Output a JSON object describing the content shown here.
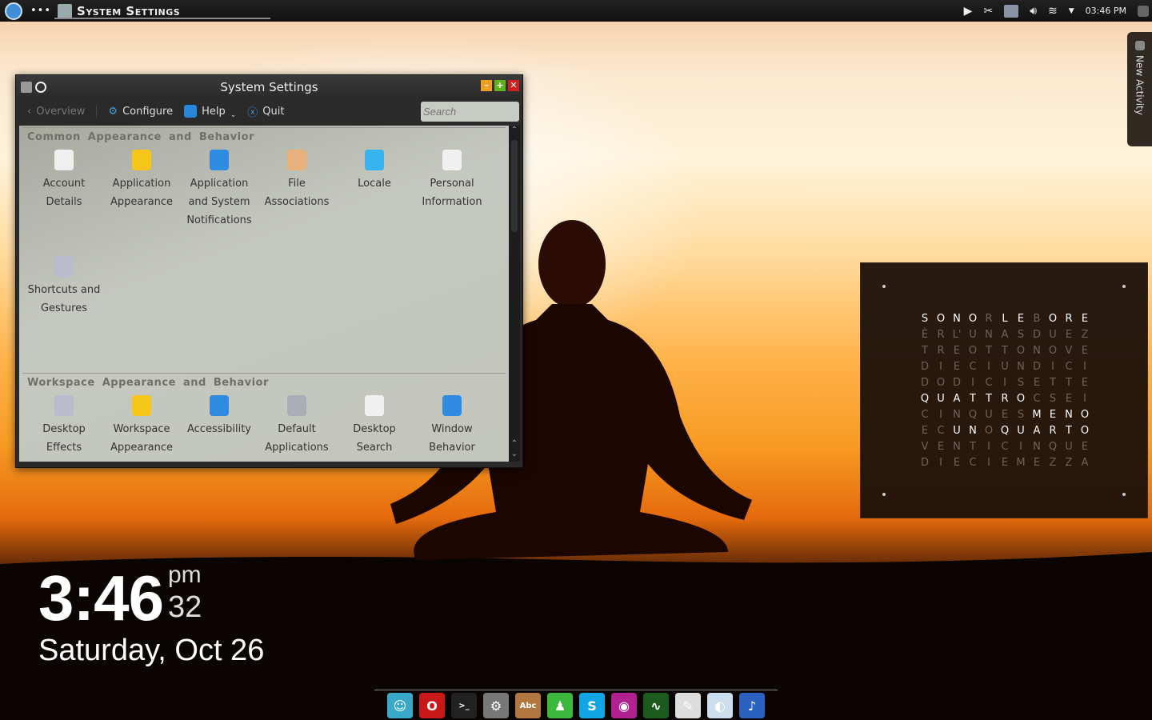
{
  "topbar": {
    "app_title": "System Settings",
    "menu_dots": "•••",
    "clock": "03:46 PM",
    "icons": [
      "kde-launcher-icon",
      "play-icon",
      "scissors-icon",
      "keyboard-icon",
      "volume-icon",
      "wifi-icon",
      "tray-expand-icon",
      "activity-icon"
    ]
  },
  "new_activity": {
    "label": "New Activity"
  },
  "window": {
    "title": "System Settings",
    "toolbar": {
      "overview": "Overview",
      "configure": "Configure",
      "help": "Help",
      "quit": "Quit",
      "search_placeholder": "Search"
    },
    "sections": [
      {
        "title": "Common Appearance and Behavior",
        "items": [
          {
            "label": "Account Details",
            "icon": "account-icon",
            "color": "#f0f0f0"
          },
          {
            "label": "Application Appearance",
            "icon": "shirt-icon",
            "color": "#f5c518"
          },
          {
            "label": "Application and System Notifications",
            "icon": "notification-icon",
            "color": "#2f8be0"
          },
          {
            "label": "File Associations",
            "icon": "archive-icon",
            "color": "#e8b07a"
          },
          {
            "label": "Locale",
            "icon": "locale-icon",
            "color": "#36b4ef"
          },
          {
            "label": "Personal Information",
            "icon": "person-icon",
            "color": "#f0f0f0"
          },
          {
            "label": "Shortcuts and Gestures",
            "icon": "keyboard-icon",
            "color": "#b8bccb"
          }
        ]
      },
      {
        "title": "Workspace Appearance and Behavior",
        "items": [
          {
            "label": "Desktop Effects",
            "icon": "sliders-icon",
            "color": "#b8bccb"
          },
          {
            "label": "Workspace Appearance",
            "icon": "shirt-icon",
            "color": "#f5c518"
          },
          {
            "label": "Accessibility",
            "icon": "accessibility-icon",
            "color": "#2f8be0"
          },
          {
            "label": "Default Applications",
            "icon": "gear-icon",
            "color": "#a9adb5"
          },
          {
            "label": "Desktop Search",
            "icon": "branch-icon",
            "color": "#f0f0f0"
          },
          {
            "label": "Window Behavior",
            "icon": "window-icon",
            "color": "#2f8be0"
          }
        ]
      }
    ]
  },
  "desktop_clock": {
    "time": "3:46",
    "ampm": "pm",
    "seconds": "32",
    "date": "Saturday, Oct 26"
  },
  "word_clock": {
    "rows": [
      {
        "letters": [
          "S",
          "O",
          "N",
          "O",
          "R",
          "L",
          "E",
          "B",
          "O",
          "R",
          "E"
        ],
        "lit": [
          0,
          1,
          2,
          3,
          5,
          6,
          8,
          9,
          10
        ]
      },
      {
        "letters": [
          "È",
          "R",
          "L'",
          "U",
          "N",
          "A",
          "S",
          "D",
          "U",
          "E",
          "Z"
        ],
        "lit": []
      },
      {
        "letters": [
          "T",
          "R",
          "E",
          "O",
          "T",
          "T",
          "O",
          "N",
          "O",
          "V",
          "E"
        ],
        "lit": []
      },
      {
        "letters": [
          "D",
          "I",
          "E",
          "C",
          "I",
          "U",
          "N",
          "D",
          "I",
          "C",
          "I"
        ],
        "lit": []
      },
      {
        "letters": [
          "D",
          "O",
          "D",
          "I",
          "C",
          "I",
          "S",
          "E",
          "T",
          "T",
          "E"
        ],
        "lit": []
      },
      {
        "letters": [
          "Q",
          "U",
          "A",
          "T",
          "T",
          "R",
          "O",
          "C",
          "S",
          "E",
          "I"
        ],
        "lit": [
          0,
          1,
          2,
          3,
          4,
          5,
          6
        ]
      },
      {
        "letters": [
          "C",
          "I",
          "N",
          "Q",
          "U",
          "E",
          "S",
          "M",
          "E",
          "N",
          "O"
        ],
        "lit": [
          7,
          8,
          9,
          10
        ]
      },
      {
        "letters": [
          "E",
          "C",
          "U",
          "N",
          "O",
          "Q",
          "U",
          "A",
          "R",
          "T",
          "O"
        ],
        "lit": [
          2,
          3,
          5,
          6,
          7,
          8,
          9,
          10
        ]
      },
      {
        "letters": [
          "V",
          "E",
          "N",
          "T",
          "I",
          "C",
          "I",
          "N",
          "Q",
          "U",
          "E"
        ],
        "lit": []
      },
      {
        "letters": [
          "D",
          "I",
          "E",
          "C",
          "I",
          "E",
          "M",
          "E",
          "Z",
          "Z",
          "A"
        ],
        "lit": []
      }
    ]
  },
  "dock": [
    {
      "name": "finder",
      "glyph": "☺",
      "color": "#3aa8c8"
    },
    {
      "name": "opera",
      "glyph": "O",
      "color": "#c81818"
    },
    {
      "name": "terminal",
      "glyph": ">_",
      "color": "#222"
    },
    {
      "name": "system-preferences",
      "glyph": "⚙",
      "color": "#777"
    },
    {
      "name": "dictionary",
      "glyph": "Abc",
      "color": "#b07840"
    },
    {
      "name": "green-app",
      "glyph": "♟",
      "color": "#3cb83c"
    },
    {
      "name": "skype",
      "glyph": "S",
      "color": "#12a5e6"
    },
    {
      "name": "eye-app",
      "glyph": "◉",
      "color": "#b02090"
    },
    {
      "name": "activity-monitor",
      "glyph": "∿",
      "color": "#1d5a1d"
    },
    {
      "name": "text-editor",
      "glyph": "✎",
      "color": "#ddd"
    },
    {
      "name": "preview",
      "glyph": "◐",
      "color": "#cde"
    },
    {
      "name": "music",
      "glyph": "♪",
      "color": "#2a60c0"
    }
  ]
}
